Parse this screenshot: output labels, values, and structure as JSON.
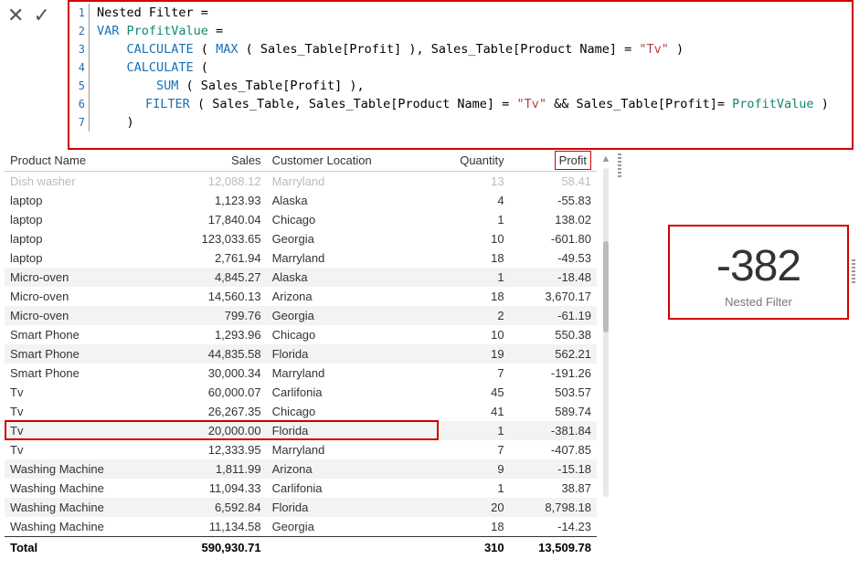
{
  "formula": {
    "lines": [
      {
        "n": "1",
        "measure": "Nested Filter",
        "eq": " ="
      },
      {
        "n": "2",
        "pre": "VAR ",
        "var": "ProfitValue",
        "eq": " ="
      },
      {
        "n": "3",
        "pre": "    ",
        "fn": "CALCULATE",
        "mid": " ( ",
        "fn2": "MAX",
        "args": " ( Sales_Table[Profit] ), Sales_Table[Product Name] = ",
        "str": "\"Tv\"",
        "post": " )"
      },
      {
        "n": "4",
        "pre": "    ",
        "fn": "CALCULATE",
        "post": " ("
      },
      {
        "n": "5",
        "pre": "        ",
        "fn": "SUM",
        "post": " ( Sales_Table[Profit] ),"
      },
      {
        "n": "6",
        "pre": "        ",
        "fn": "FILTER",
        "mid": " ( Sales_Table, Sales_Table[Product Name] = ",
        "str": "\"Tv\"",
        "and": " && Sales_Table[Profit]= ",
        "var": "ProfitValue",
        "post": " )"
      },
      {
        "n": "7",
        "pre": "    ",
        "post": ")"
      }
    ]
  },
  "table": {
    "headers": {
      "c0": "Product Name",
      "c1": "Sales",
      "c2": "Customer Location",
      "c3": "Quantity",
      "c4": "Profit"
    },
    "rows": [
      {
        "c0": "Dish washer",
        "c1": "12,088.12",
        "c2": "Marryland",
        "c3": "13",
        "c4": "58.41",
        "cut": true
      },
      {
        "c0": "laptop",
        "c1": "1,123.93",
        "c2": "Alaska",
        "c3": "4",
        "c4": "-55.83"
      },
      {
        "c0": "laptop",
        "c1": "17,840.04",
        "c2": "Chicago",
        "c3": "1",
        "c4": "138.02"
      },
      {
        "c0": "laptop",
        "c1": "123,033.65",
        "c2": "Georgia",
        "c3": "10",
        "c4": "-601.80"
      },
      {
        "c0": "laptop",
        "c1": "2,761.94",
        "c2": "Marryland",
        "c3": "18",
        "c4": "-49.53"
      },
      {
        "c0": "Micro-oven",
        "c1": "4,845.27",
        "c2": "Alaska",
        "c3": "1",
        "c4": "-18.48",
        "alt": true
      },
      {
        "c0": "Micro-oven",
        "c1": "14,560.13",
        "c2": "Arizona",
        "c3": "18",
        "c4": "3,670.17"
      },
      {
        "c0": "Micro-oven",
        "c1": "799.76",
        "c2": "Georgia",
        "c3": "2",
        "c4": "-61.19",
        "alt": true
      },
      {
        "c0": "Smart Phone",
        "c1": "1,293.96",
        "c2": "Chicago",
        "c3": "10",
        "c4": "550.38"
      },
      {
        "c0": "Smart Phone",
        "c1": "44,835.58",
        "c2": "Florida",
        "c3": "19",
        "c4": "562.21",
        "alt": true
      },
      {
        "c0": "Smart Phone",
        "c1": "30,000.34",
        "c2": "Marryland",
        "c3": "7",
        "c4": "-191.26"
      },
      {
        "c0": "Tv",
        "c1": "60,000.07",
        "c2": "Carlifonia",
        "c3": "45",
        "c4": "503.57"
      },
      {
        "c0": "Tv",
        "c1": "26,267.35",
        "c2": "Chicago",
        "c3": "41",
        "c4": "589.74"
      },
      {
        "c0": "Tv",
        "c1": "20,000.00",
        "c2": "Florida",
        "c3": "1",
        "c4": "-381.84",
        "alt": true,
        "hl": true
      },
      {
        "c0": "Tv",
        "c1": "12,333.95",
        "c2": "Marryland",
        "c3": "7",
        "c4": "-407.85"
      },
      {
        "c0": "Washing Machine",
        "c1": "1,811.99",
        "c2": "Arizona",
        "c3": "9",
        "c4": "-15.18",
        "alt": true
      },
      {
        "c0": "Washing Machine",
        "c1": "11,094.33",
        "c2": "Carlifonia",
        "c3": "1",
        "c4": "38.87"
      },
      {
        "c0": "Washing Machine",
        "c1": "6,592.84",
        "c2": "Florida",
        "c3": "20",
        "c4": "8,798.18",
        "alt": true
      },
      {
        "c0": "Washing Machine",
        "c1": "11,134.58",
        "c2": "Georgia",
        "c3": "18",
        "c4": "-14.23"
      }
    ],
    "total": {
      "label": "Total",
      "c1": "590,930.71",
      "c3": "310",
      "c4": "13,509.78"
    }
  },
  "card": {
    "value": "-382",
    "label": "Nested Filter"
  }
}
